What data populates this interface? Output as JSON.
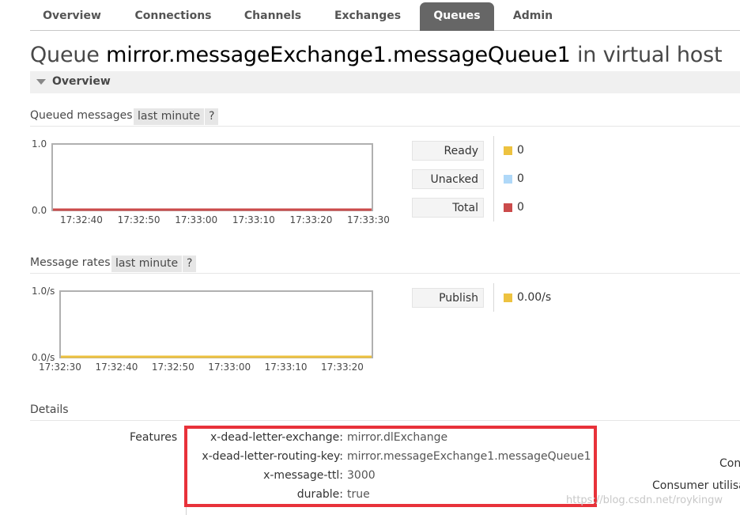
{
  "nav": {
    "tabs": [
      {
        "label": "Overview"
      },
      {
        "label": "Connections"
      },
      {
        "label": "Channels"
      },
      {
        "label": "Exchanges"
      },
      {
        "label": "Queues"
      },
      {
        "label": "Admin"
      }
    ]
  },
  "title": {
    "prefix": "Queue ",
    "queue_name": "mirror.messageExchange1.messageQueue1",
    "suffix": " in virtual host"
  },
  "overview": {
    "section_label": "Overview",
    "queued": {
      "label": "Queued messages",
      "range": "last minute",
      "help": "?",
      "legend": [
        {
          "label": "Ready",
          "value": "0",
          "color": "#edc240"
        },
        {
          "label": "Unacked",
          "value": "0",
          "color": "#afd8f8"
        },
        {
          "label": "Total",
          "value": "0",
          "color": "#cb4b4b"
        }
      ]
    },
    "rates": {
      "label": "Message rates",
      "range": "last minute",
      "help": "?",
      "legend": [
        {
          "label": "Publish",
          "value": "0.00/s",
          "color": "#edc240"
        }
      ]
    }
  },
  "chart_data": [
    {
      "type": "line",
      "ylim": [
        0,
        1.0
      ],
      "y_ticks": [
        "1.0",
        "0.0"
      ],
      "x": [
        "17:32:40",
        "17:32:50",
        "17:33:00",
        "17:33:10",
        "17:33:20",
        "17:33:30"
      ],
      "series": [
        {
          "name": "Total",
          "values": [
            0,
            0,
            0,
            0,
            0,
            0
          ],
          "color": "#cb4b4b"
        }
      ]
    },
    {
      "type": "line",
      "ylim": [
        0,
        1.0
      ],
      "y_ticks": [
        "1.0/s",
        "0.0/s"
      ],
      "x": [
        "17:32:30",
        "17:32:40",
        "17:32:50",
        "17:33:00",
        "17:33:10",
        "17:33:20"
      ],
      "series": [
        {
          "name": "Publish",
          "values": [
            0,
            0,
            0,
            0,
            0,
            0
          ],
          "color": "#edc240"
        }
      ]
    }
  ],
  "details": {
    "label": "Details",
    "features_label": "Features",
    "features": [
      {
        "key": "x-dead-letter-exchange:",
        "value": "mirror.dlExchange"
      },
      {
        "key": "x-dead-letter-routing-key:",
        "value": "mirror.messageExchange1.messageQueue1"
      },
      {
        "key": "x-message-ttl:",
        "value": "3000"
      },
      {
        "key": "durable:",
        "value": "true"
      }
    ],
    "right_labels": [
      "Con",
      "Consumer utilisa"
    ]
  },
  "watermark": "https://blog.csdn.net/roykingw",
  "colors": {
    "active_tab": "#666666",
    "highlight_box": "#e8323a"
  }
}
